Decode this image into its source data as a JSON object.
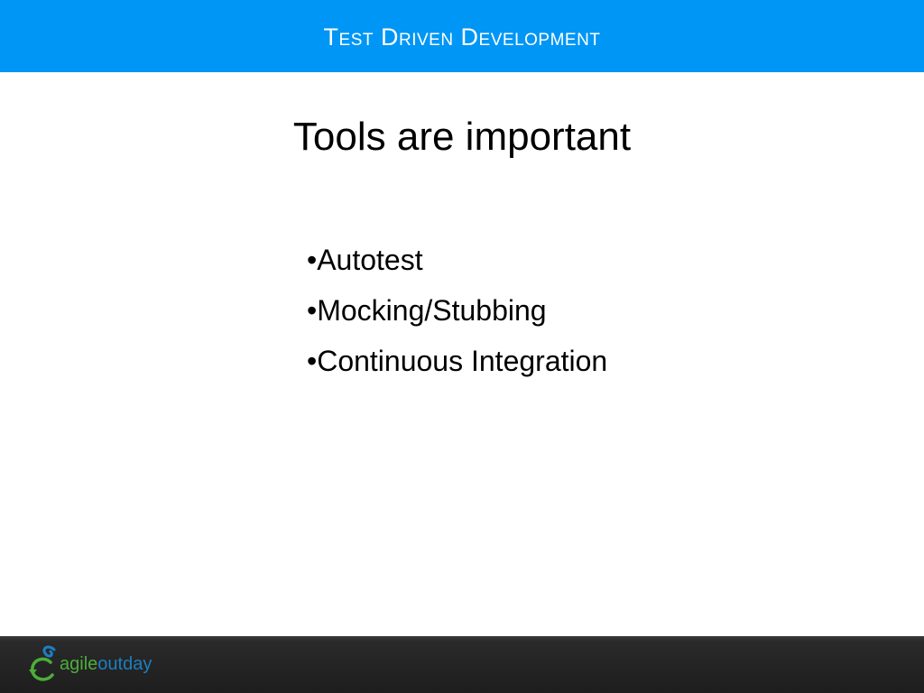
{
  "header": {
    "title": "Test Driven Development"
  },
  "slide": {
    "title": "Tools are important",
    "bullets": [
      "•Autotest",
      "•Mocking/Stubbing",
      "•Continuous Integration"
    ]
  },
  "footer": {
    "logo_text_primary": "agile",
    "logo_text_secondary": "outday",
    "logo_icon": "agileoutday-logo-icon"
  },
  "colors": {
    "header_blue": "#0096f5",
    "footer_dark": "#1e1e1e",
    "logo_green": "#4cae3a",
    "logo_blue": "#1c7fc2"
  }
}
